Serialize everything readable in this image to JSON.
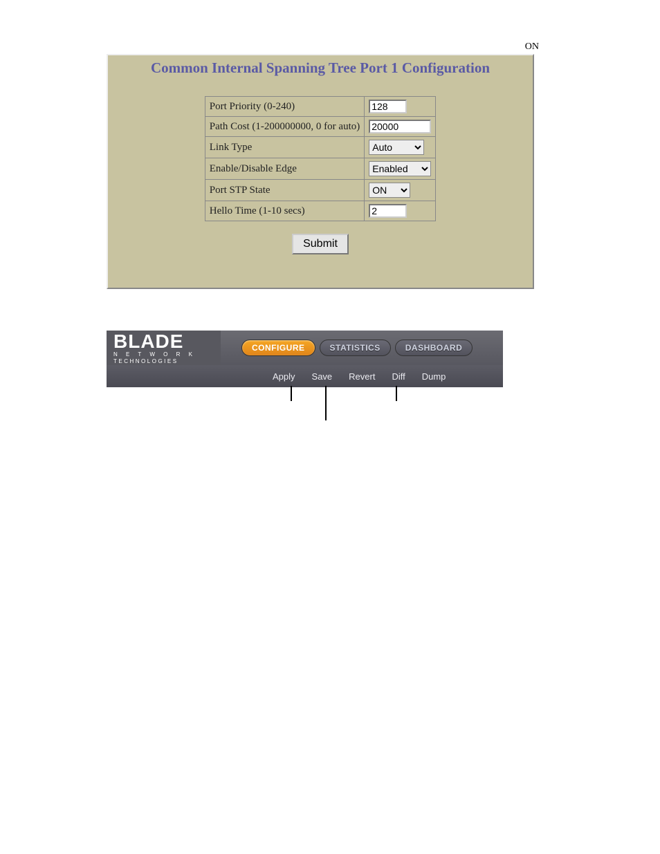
{
  "top_right": "ON",
  "panel": {
    "title": "Common Internal Spanning Tree Port 1 Configuration",
    "rows": [
      {
        "label": "Port Priority (0-240)",
        "value": "128",
        "type": "text",
        "wide": false
      },
      {
        "label": "Path Cost (1-200000000, 0 for auto)",
        "value": "20000",
        "type": "text",
        "wide": true
      },
      {
        "label": "Link Type",
        "value": "Auto",
        "type": "select",
        "options": [
          "Auto"
        ]
      },
      {
        "label": "Enable/Disable Edge",
        "value": "Enabled",
        "type": "select",
        "options": [
          "Enabled"
        ]
      },
      {
        "label": "Port STP State",
        "value": "ON",
        "type": "select",
        "options": [
          "ON"
        ]
      },
      {
        "label": "Hello Time (1-10 secs)",
        "value": "2",
        "type": "text",
        "wide": false
      }
    ],
    "submit": "Submit"
  },
  "toolbar": {
    "logo": {
      "main": "BLADE",
      "sub1": "N E T W O R K",
      "sub2": "TECHNOLOGIES"
    },
    "tabs": [
      {
        "label": "CONFIGURE",
        "active": true
      },
      {
        "label": "STATISTICS",
        "active": false
      },
      {
        "label": "DASHBOARD",
        "active": false
      }
    ],
    "links": [
      "Apply",
      "Save",
      "Revert",
      "Diff",
      "Dump"
    ]
  }
}
